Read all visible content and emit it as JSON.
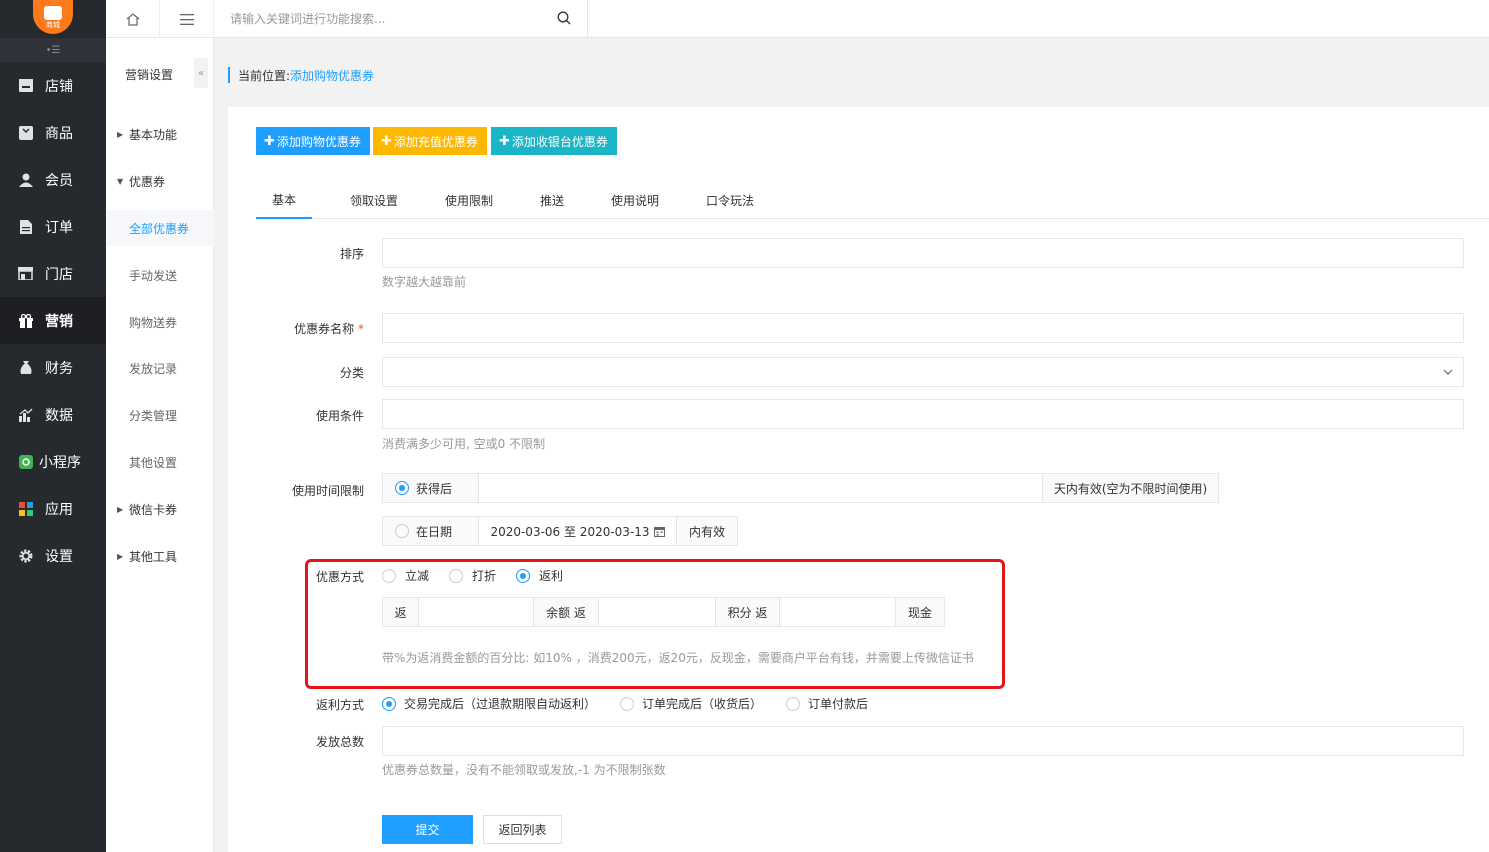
{
  "logo": {
    "text": "商城"
  },
  "nav": {
    "items": [
      {
        "label": "店铺",
        "icon": "store-icon"
      },
      {
        "label": "商品",
        "icon": "goods-icon"
      },
      {
        "label": "会员",
        "icon": "member-icon"
      },
      {
        "label": "订单",
        "icon": "order-icon"
      },
      {
        "label": "门店",
        "icon": "shop-icon"
      },
      {
        "label": "营销",
        "icon": "gift-icon",
        "active": true
      },
      {
        "label": "财务",
        "icon": "money-bag-icon"
      },
      {
        "label": "数据",
        "icon": "chart-icon"
      },
      {
        "label": "小程序",
        "icon": "miniprogram-icon"
      },
      {
        "label": "应用",
        "icon": "apps-icon"
      },
      {
        "label": "设置",
        "icon": "gear-icon"
      }
    ]
  },
  "subnav": {
    "title": "营销设置",
    "items": [
      {
        "label": "基本功能",
        "type": "group",
        "expanded": false
      },
      {
        "label": "优惠券",
        "type": "group",
        "expanded": true
      },
      {
        "label": "全部优惠券",
        "type": "child",
        "active": true
      },
      {
        "label": "手动发送",
        "type": "child"
      },
      {
        "label": "购物送券",
        "type": "child"
      },
      {
        "label": "发放记录",
        "type": "child"
      },
      {
        "label": "分类管理",
        "type": "child"
      },
      {
        "label": "其他设置",
        "type": "child"
      },
      {
        "label": "微信卡券",
        "type": "group",
        "expanded": false
      },
      {
        "label": "其他工具",
        "type": "group",
        "expanded": false
      }
    ]
  },
  "topbar": {
    "search_placeholder": "请输入关键词进行功能搜索..."
  },
  "breadcrumb": {
    "label": "当前位置:",
    "current": "添加购物优惠券"
  },
  "actions": {
    "add_shopping": "添加购物优惠券",
    "add_recharge": "添加充值优惠券",
    "add_cashier": "添加收银台优惠券",
    "colors": {
      "shopping": "#1e9fff",
      "recharge": "#ffb800",
      "cashier": "#1ab6c8"
    }
  },
  "tabs": [
    "基本",
    "领取设置",
    "使用限制",
    "推送",
    "使用说明",
    "口令玩法"
  ],
  "form": {
    "sort": {
      "label": "排序",
      "value": "",
      "hint": "数字越大越靠前"
    },
    "name": {
      "label": "优惠券名称",
      "required_mark": "*",
      "value": ""
    },
    "category": {
      "label": "分类",
      "value": ""
    },
    "condition": {
      "label": "使用条件",
      "value": "",
      "hint": "消费满多少可用, 空或0 不限制"
    },
    "time_limit": {
      "label": "使用时间限制",
      "option_after": "获得后",
      "after_value": "",
      "after_suffix": "天内有效(空为不限时间使用)",
      "option_date": "在日期",
      "date_range": "2020-03-06 至 2020-03-13",
      "date_suffix": "内有效"
    },
    "discount": {
      "label": "优惠方式",
      "options": [
        "立减",
        "打折",
        "返利"
      ],
      "selected": "返利",
      "return_prefix": "返",
      "balance_label": "余额 返",
      "points_label": "积分 返",
      "cash_label": "现金",
      "hint": "带%为返消费金额的百分比: 如10% ，消费200元，返20元，反现金，需要商户平台有钱，并需要上传微信证书"
    },
    "rebate": {
      "label": "返利方式",
      "options": [
        "交易完成后（过退款期限自动返利）",
        "订单完成后（收货后）",
        "订单付款后"
      ],
      "selected": "交易完成后（过退款期限自动返利）"
    },
    "total": {
      "label": "发放总数",
      "value": "",
      "hint": "优惠券总数量，没有不能领取或发放,-1 为不限制张数"
    },
    "submit": "提交",
    "back": "返回列表"
  }
}
